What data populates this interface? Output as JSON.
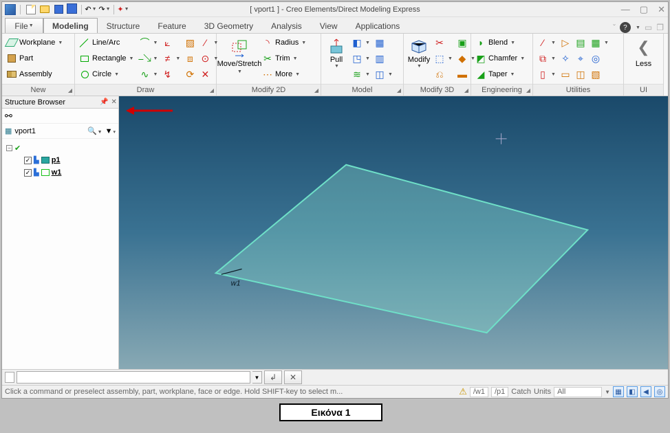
{
  "title": "[ vport1 ] - Creo Elements/Direct Modeling Express",
  "tabs": {
    "file": "File",
    "modeling": "Modeling",
    "structure": "Structure",
    "feature": "Feature",
    "geometry": "3D Geometry",
    "analysis": "Analysis",
    "view": "View",
    "applications": "Applications"
  },
  "groups": {
    "new": {
      "label": "New",
      "workplane": "Workplane",
      "part": "Part",
      "assembly": "Assembly"
    },
    "draw": {
      "label": "Draw",
      "linearc": "Line/Arc",
      "rectangle": "Rectangle",
      "circle": "Circle"
    },
    "modify2d": {
      "label": "Modify 2D",
      "movestretch": "Move/Stretch",
      "radius": "Radius",
      "trim": "Trim",
      "more": "More"
    },
    "model": {
      "label": "Model",
      "pull": "Pull"
    },
    "modify3d": {
      "label": "Modify 3D",
      "modify": "Modify"
    },
    "engineering": {
      "label": "Engineering",
      "blend": "Blend",
      "chamfer": "Chamfer",
      "taper": "Taper"
    },
    "utilities": {
      "label": "Utilities"
    },
    "ui": {
      "label": "UI",
      "less": "Less"
    }
  },
  "browser": {
    "header": "Structure Browser",
    "root": "vport1",
    "items": [
      {
        "name": "p1",
        "color": "#2aa6a0"
      },
      {
        "name": "w1",
        "color": "#18c018"
      }
    ]
  },
  "viewport": {
    "annot": "w1"
  },
  "status": {
    "msg": "Click a command or preselect assembly, part, workplane, face or edge. Hold SHIFT-key to select m...",
    "wp": "/w1",
    "pt": "/p1",
    "catch": "Catch",
    "units": "Units",
    "all": "All"
  },
  "caption": "Εικόνα 1"
}
